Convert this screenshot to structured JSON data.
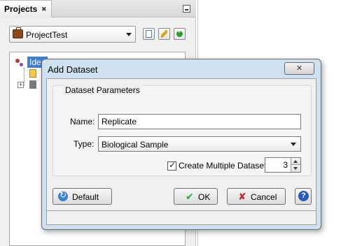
{
  "projects_panel": {
    "tab_label": "Projects",
    "tab_close_glyph": "✖",
    "project_selector": {
      "selected": "ProjectTest"
    },
    "tree": {
      "root_label": "Iden"
    }
  },
  "dialog": {
    "title": "Add Dataset",
    "close_glyph": "✕",
    "group_title": "Dataset Parameters",
    "name_label": "Name:",
    "name_value": "Replicate",
    "type_label": "Type:",
    "type_value": "Biological Sample",
    "create_multiple_label": "Create Multiple Datasets",
    "create_multiple_checked": true,
    "multiple_count": "3",
    "buttons": {
      "default": "Default",
      "ok": "OK",
      "cancel": "Cancel",
      "help_glyph": "?"
    }
  },
  "icons": {
    "ok_glyph": "✔",
    "cancel_glyph": "✘"
  }
}
